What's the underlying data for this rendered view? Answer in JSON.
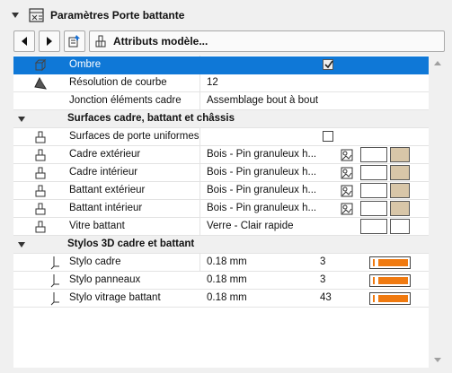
{
  "panel": {
    "title": "Paramètres Porte battante",
    "toolbar": {
      "attributes_label": "Attributs modèle..."
    }
  },
  "rows": {
    "ombre": {
      "label": "Ombre",
      "checked": true
    },
    "resolution": {
      "label": "Résolution de courbe",
      "value": "12"
    },
    "jonction": {
      "label": "Jonction éléments cadre",
      "value": "Assemblage bout à bout"
    },
    "sec_surfaces": {
      "label": "Surfaces cadre, battant et châssis"
    },
    "surf_uniformes": {
      "label": "Surfaces de porte uniformes",
      "checked": false
    },
    "cadre_ext": {
      "label": "Cadre extérieur",
      "value": "Bois - Pin granuleux h..."
    },
    "cadre_int": {
      "label": "Cadre intérieur",
      "value": "Bois - Pin granuleux h..."
    },
    "battant_ext": {
      "label": "Battant extérieur",
      "value": "Bois - Pin granuleux h..."
    },
    "battant_int": {
      "label": "Battant intérieur",
      "value": "Bois - Pin granuleux h..."
    },
    "vitre": {
      "label": "Vitre battant",
      "value": "Verre - Clair rapide"
    },
    "sec_stylos": {
      "label": "Stylos 3D cadre et battant"
    },
    "stylo_cadre": {
      "label": "Stylo cadre",
      "value": "0.18 mm",
      "num": "3"
    },
    "stylo_panneaux": {
      "label": "Stylo panneaux",
      "value": "0.18 mm",
      "num": "3"
    },
    "stylo_vitrage": {
      "label": "Stylo vitrage battant",
      "value": "0.18 mm",
      "num": "43"
    }
  },
  "colors": {
    "selection": "#0f78d7",
    "wood_swatch": "#d8c6a8",
    "pen": "#f07a10"
  }
}
